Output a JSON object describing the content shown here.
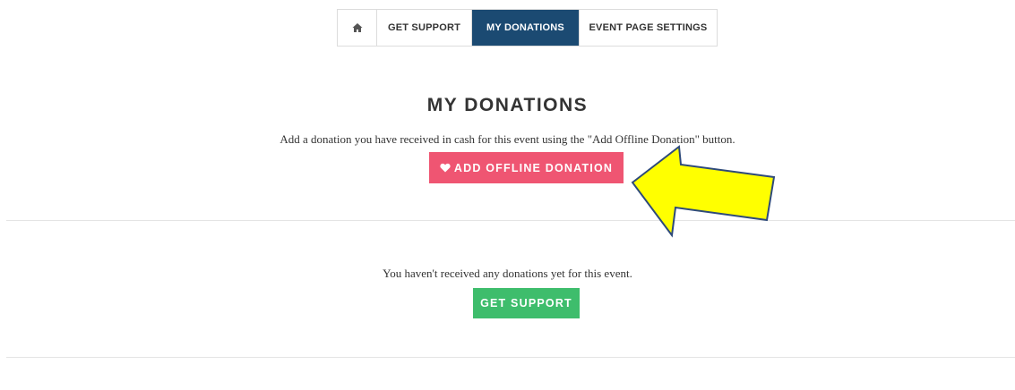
{
  "tabs": {
    "home_icon": "home-icon",
    "get_support": "GET SUPPORT",
    "my_donations": "MY DONATIONS",
    "event_page_settings": "EVENT PAGE SETTINGS",
    "active": "MY DONATIONS"
  },
  "main": {
    "title": "MY DONATIONS",
    "description": "Add a donation you have received in cash for this event using the \"Add Offline Donation\" button.",
    "add_offline_button": {
      "icon": "heart-icon",
      "label": "ADD OFFLINE DONATION"
    },
    "empty_message": "You haven't received any donations yet for this event.",
    "get_support_button": "GET SUPPORT"
  },
  "annotation": {
    "icon": "arrow-pointer-icon"
  },
  "colors": {
    "active_tab": "#1b4a72",
    "offline_button": "#ef5572",
    "support_button": "#3ebd6c",
    "arrow_fill": "#ffff00",
    "arrow_stroke": "#2e4a7a"
  }
}
